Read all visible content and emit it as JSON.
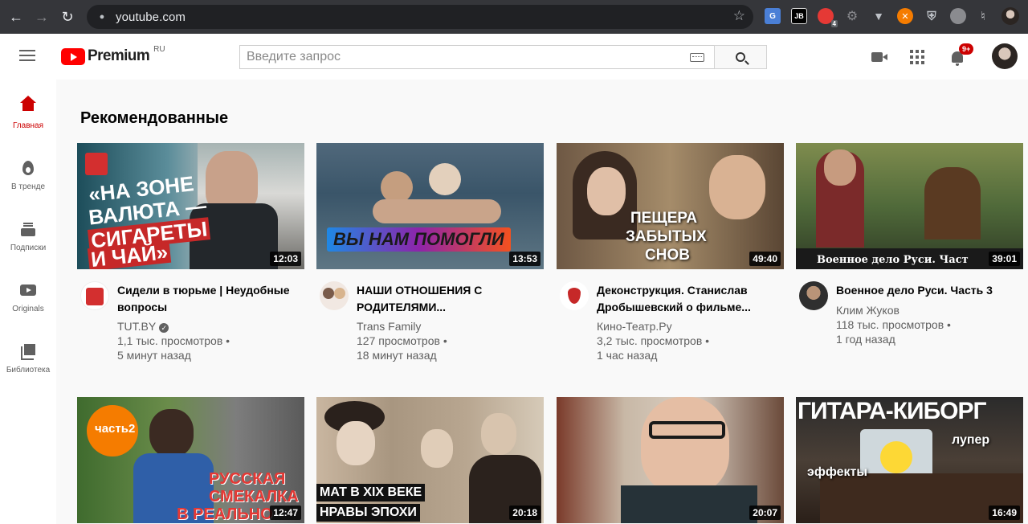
{
  "browser": {
    "url": "youtube.com",
    "extensions": [
      "translate-icon",
      "jetbrains-icon",
      "pdf-icon",
      "gear-icon",
      "v-icon",
      "cross-icon",
      "shield-icon",
      "globe-icon",
      "puzzle-icon",
      "profile-icon"
    ],
    "ext_badge": "4"
  },
  "masthead": {
    "logo_text": "Premium",
    "region": "RU",
    "search_placeholder": "Введите запрос",
    "notifications_badge": "9+"
  },
  "sidebar": {
    "items": [
      {
        "label": "Главная",
        "icon": "home-icon"
      },
      {
        "label": "В тренде",
        "icon": "flame-icon"
      },
      {
        "label": "Подписки",
        "icon": "subscriptions-icon"
      },
      {
        "label": "Originals",
        "icon": "originals-icon"
      },
      {
        "label": "Библиотека",
        "icon": "library-icon"
      }
    ]
  },
  "main": {
    "section_title": "Рекомендованные",
    "videos": [
      {
        "title_line1": "Сидели в тюрьме | Неудобные",
        "title_line2": "вопросы",
        "channel": "TUT.BY",
        "views": "1,1 тыс. просмотров •",
        "age": "5 минут назад",
        "duration": "12:03",
        "thumb_text": [
          "«НА ЗОНЕ",
          "ВАЛЮТА —",
          "СИГАРЕТЫ",
          "И ЧАЙ»"
        ]
      },
      {
        "title_line1": "НАШИ ОТНОШЕНИЯ С",
        "title_line2": "РОДИТЕЛЯМИ...",
        "channel": "Trans Family",
        "views": "127 просмотров •",
        "age": "18 минут назад",
        "duration": "13:53",
        "thumb_text": [
          "ВЫ НАМ ПОМОГЛИ"
        ]
      },
      {
        "title_line1": "Деконструкция. Станислав",
        "title_line2": "Дробышевский о фильме...",
        "channel": "Кино-Театр.Ру",
        "views": "3,2 тыс. просмотров •",
        "age": "1 час назад",
        "duration": "49:40",
        "thumb_text": [
          "ПЕЩЕРА",
          "ЗАБЫТЫХ",
          "СНОВ"
        ]
      },
      {
        "title_line1": "Военное дело Руси. Часть 3",
        "title_line2": "",
        "channel": "Клим Жуков",
        "views": "118 тыс. просмотров •",
        "age": "1 год назад",
        "duration": "39:01",
        "thumb_text": [
          "Военное дело Руси. Част"
        ]
      },
      {
        "duration": "12:47",
        "thumb_text": [
          "часть2",
          "РУССКАЯ",
          "СМЕКАЛКА",
          "В РЕАЛЬНО"
        ]
      },
      {
        "duration": "20:18",
        "thumb_text": [
          "МАТ В XIX ВЕКЕ",
          "НРАВЫ ЭПОХИ"
        ]
      },
      {
        "duration": "20:07",
        "thumb_text": []
      },
      {
        "duration": "16:49",
        "thumb_text": [
          "ГИТАРА-КИБОРГ",
          "лупер",
          "эффекты"
        ]
      }
    ]
  }
}
